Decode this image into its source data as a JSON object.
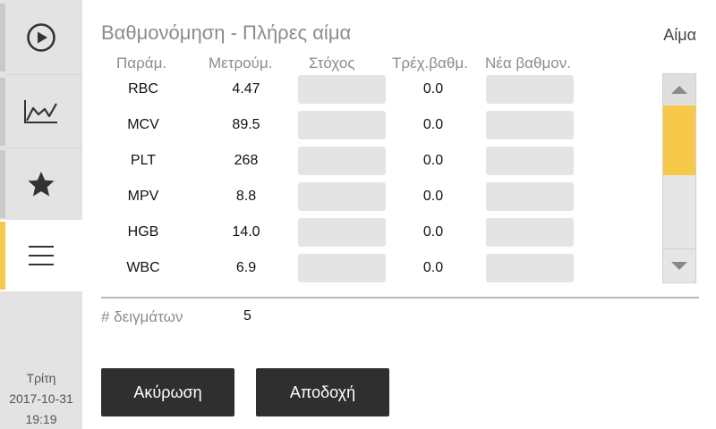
{
  "nav": {
    "items": [
      {
        "icon": "play-circle-icon",
        "active": false
      },
      {
        "icon": "trend-chart-icon",
        "active": false
      },
      {
        "icon": "star-icon",
        "active": false
      },
      {
        "icon": "menu-icon",
        "active": true
      }
    ],
    "accent_color": "#f7c94b"
  },
  "system": {
    "day": "Τρίτη",
    "date": "2017-10-31",
    "time": "19:19"
  },
  "header": {
    "title": "Βαθμονόμηση - Πλήρες αίμα",
    "context": "Αίμα"
  },
  "table": {
    "columns": {
      "param": "Παράμ.",
      "measured": "Μετρούμ.",
      "target": "Στόχος",
      "current_cal": "Τρέχ.βαθμ.",
      "new_cal": "Νέα βαθμον."
    },
    "rows": [
      {
        "param": "RBC",
        "measured": "4.47",
        "target": "",
        "current_cal": "0.0",
        "new_cal": ""
      },
      {
        "param": "MCV",
        "measured": "89.5",
        "target": "",
        "current_cal": "0.0",
        "new_cal": ""
      },
      {
        "param": "PLT",
        "measured": "268",
        "target": "",
        "current_cal": "0.0",
        "new_cal": ""
      },
      {
        "param": "MPV",
        "measured": "8.8",
        "target": "",
        "current_cal": "0.0",
        "new_cal": ""
      },
      {
        "param": "HGB",
        "measured": "14.0",
        "target": "",
        "current_cal": "0.0",
        "new_cal": ""
      },
      {
        "param": "WBC",
        "measured": "6.9",
        "target": "",
        "current_cal": "0.0",
        "new_cal": ""
      }
    ]
  },
  "samples": {
    "label": "# δειγμάτων",
    "value": "5"
  },
  "actions": {
    "cancel_label": "Ακύρωση",
    "accept_label": "Αποδοχή"
  }
}
